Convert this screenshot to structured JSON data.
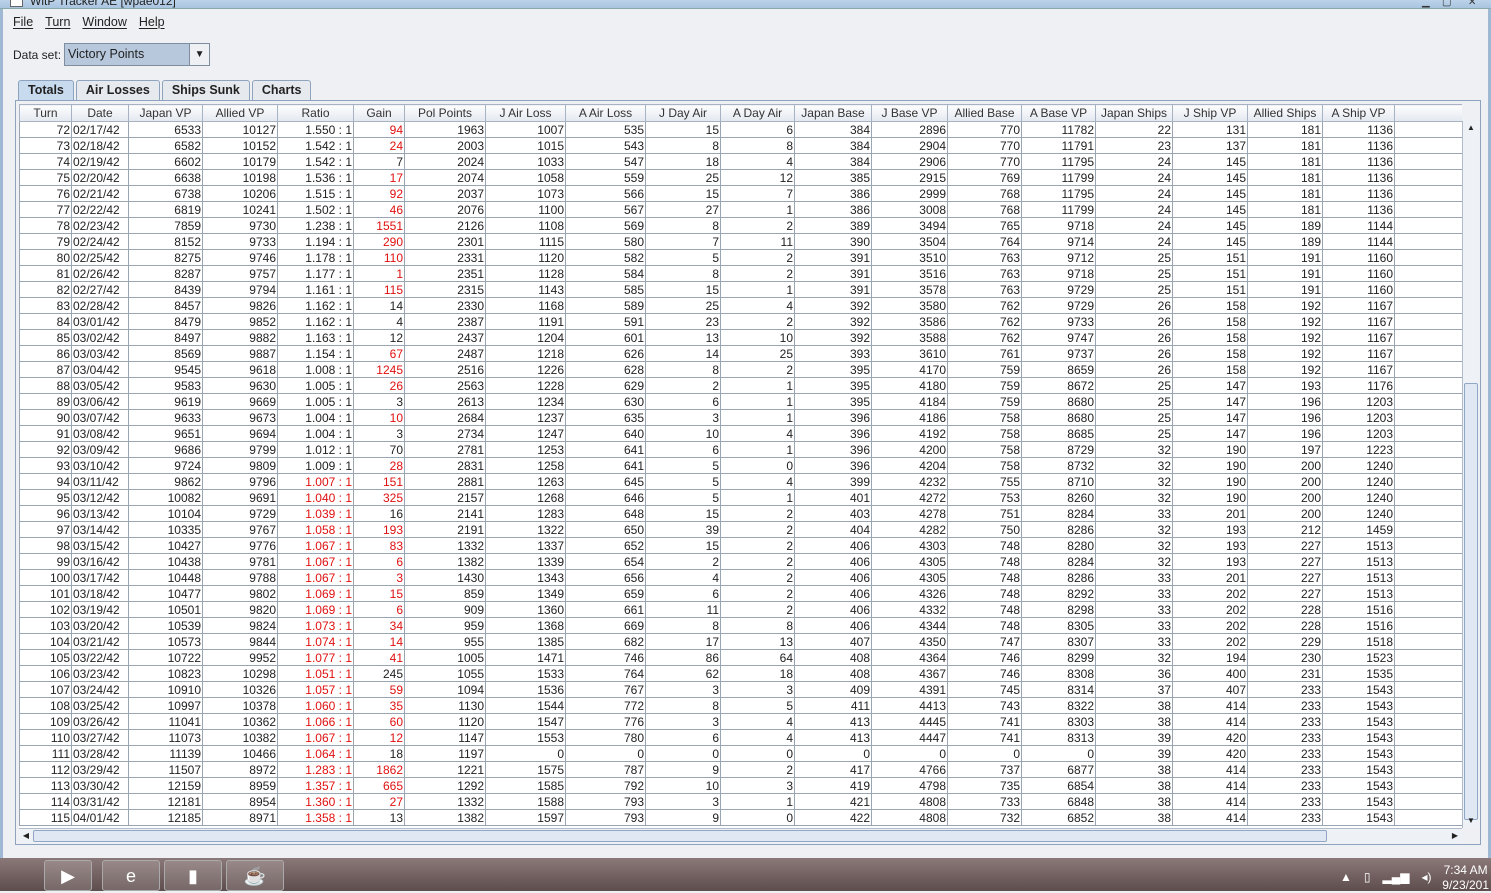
{
  "window": {
    "title": "WitP Tracker AE [wpae012]"
  },
  "menu": [
    "File",
    "Turn",
    "Window",
    "Help"
  ],
  "dataset": {
    "label": "Data set:",
    "value": "Victory Points"
  },
  "tabs": [
    "Totals",
    "Air Losses",
    "Ships Sunk",
    "Charts"
  ],
  "active_tab": "Totals",
  "colors": {
    "highlight": "#e01010",
    "selected_tab": "#c7daee"
  },
  "table": {
    "columns": [
      "Turn",
      "Date",
      "Japan VP",
      "Allied VP",
      "Ratio",
      "Gain",
      "Pol Points",
      "J Air Loss",
      "A Air Loss",
      "J Day Air",
      "A Day Air",
      "Japan Base",
      "J Base VP",
      "Allied Base",
      "A Base VP",
      "Japan Ships",
      "J Ship VP",
      "Allied Ships",
      "A Ship VP"
    ],
    "rows": [
      [
        "72",
        "02/17/42",
        "6533",
        "10127",
        "1.550 : 1",
        "94",
        "1963",
        "1007",
        "535",
        "15",
        "6",
        "384",
        "2896",
        "770",
        "11782",
        "22",
        "131",
        "181",
        "1136"
      ],
      [
        "73",
        "02/18/42",
        "6582",
        "10152",
        "1.542 : 1",
        "24",
        "2003",
        "1015",
        "543",
        "8",
        "8",
        "384",
        "2904",
        "770",
        "11791",
        "23",
        "137",
        "181",
        "1136"
      ],
      [
        "74",
        "02/19/42",
        "6602",
        "10179",
        "1.542 : 1",
        "7",
        "2024",
        "1033",
        "547",
        "18",
        "4",
        "384",
        "2906",
        "770",
        "11795",
        "24",
        "145",
        "181",
        "1136"
      ],
      [
        "75",
        "02/20/42",
        "6638",
        "10198",
        "1.536 : 1",
        "17",
        "2074",
        "1058",
        "559",
        "25",
        "12",
        "385",
        "2915",
        "769",
        "11799",
        "24",
        "145",
        "181",
        "1136"
      ],
      [
        "76",
        "02/21/42",
        "6738",
        "10206",
        "1.515 : 1",
        "92",
        "2037",
        "1073",
        "566",
        "15",
        "7",
        "386",
        "2999",
        "768",
        "11795",
        "24",
        "145",
        "181",
        "1136"
      ],
      [
        "77",
        "02/22/42",
        "6819",
        "10241",
        "1.502 : 1",
        "46",
        "2076",
        "1100",
        "567",
        "27",
        "1",
        "386",
        "3008",
        "768",
        "11799",
        "24",
        "145",
        "181",
        "1136"
      ],
      [
        "78",
        "02/23/42",
        "7859",
        "9730",
        "1.238 : 1",
        "1551",
        "2126",
        "1108",
        "569",
        "8",
        "2",
        "389",
        "3494",
        "765",
        "9718",
        "24",
        "145",
        "189",
        "1144"
      ],
      [
        "79",
        "02/24/42",
        "8152",
        "9733",
        "1.194 : 1",
        "290",
        "2301",
        "1115",
        "580",
        "7",
        "11",
        "390",
        "3504",
        "764",
        "9714",
        "24",
        "145",
        "189",
        "1144"
      ],
      [
        "80",
        "02/25/42",
        "8275",
        "9746",
        "1.178 : 1",
        "110",
        "2331",
        "1120",
        "582",
        "5",
        "2",
        "391",
        "3510",
        "763",
        "9712",
        "25",
        "151",
        "191",
        "1160"
      ],
      [
        "81",
        "02/26/42",
        "8287",
        "9757",
        "1.177 : 1",
        "1",
        "2351",
        "1128",
        "584",
        "8",
        "2",
        "391",
        "3516",
        "763",
        "9718",
        "25",
        "151",
        "191",
        "1160"
      ],
      [
        "82",
        "02/27/42",
        "8439",
        "9794",
        "1.161 : 1",
        "115",
        "2315",
        "1143",
        "585",
        "15",
        "1",
        "391",
        "3578",
        "763",
        "9729",
        "25",
        "151",
        "191",
        "1160"
      ],
      [
        "83",
        "02/28/42",
        "8457",
        "9826",
        "1.162 : 1",
        "14",
        "2330",
        "1168",
        "589",
        "25",
        "4",
        "392",
        "3580",
        "762",
        "9729",
        "26",
        "158",
        "192",
        "1167"
      ],
      [
        "84",
        "03/01/42",
        "8479",
        "9852",
        "1.162 : 1",
        "4",
        "2387",
        "1191",
        "591",
        "23",
        "2",
        "392",
        "3586",
        "762",
        "9733",
        "26",
        "158",
        "192",
        "1167"
      ],
      [
        "85",
        "03/02/42",
        "8497",
        "9882",
        "1.163 : 1",
        "12",
        "2437",
        "1204",
        "601",
        "13",
        "10",
        "392",
        "3588",
        "762",
        "9747",
        "26",
        "158",
        "192",
        "1167"
      ],
      [
        "86",
        "03/03/42",
        "8569",
        "9887",
        "1.154 : 1",
        "67",
        "2487",
        "1218",
        "626",
        "14",
        "25",
        "393",
        "3610",
        "761",
        "9737",
        "26",
        "158",
        "192",
        "1167"
      ],
      [
        "87",
        "03/04/42",
        "9545",
        "9618",
        "1.008 : 1",
        "1245",
        "2516",
        "1226",
        "628",
        "8",
        "2",
        "395",
        "4170",
        "759",
        "8659",
        "26",
        "158",
        "192",
        "1167"
      ],
      [
        "88",
        "03/05/42",
        "9583",
        "9630",
        "1.005 : 1",
        "26",
        "2563",
        "1228",
        "629",
        "2",
        "1",
        "395",
        "4180",
        "759",
        "8672",
        "25",
        "147",
        "193",
        "1176"
      ],
      [
        "89",
        "03/06/42",
        "9619",
        "9669",
        "1.005 : 1",
        "3",
        "2613",
        "1234",
        "630",
        "6",
        "1",
        "395",
        "4184",
        "759",
        "8680",
        "25",
        "147",
        "196",
        "1203"
      ],
      [
        "90",
        "03/07/42",
        "9633",
        "9673",
        "1.004 : 1",
        "10",
        "2684",
        "1237",
        "635",
        "3",
        "1",
        "396",
        "4186",
        "758",
        "8680",
        "25",
        "147",
        "196",
        "1203"
      ],
      [
        "91",
        "03/08/42",
        "9651",
        "9694",
        "1.004 : 1",
        "3",
        "2734",
        "1247",
        "640",
        "10",
        "4",
        "396",
        "4192",
        "758",
        "8685",
        "25",
        "147",
        "196",
        "1203"
      ],
      [
        "92",
        "03/09/42",
        "9686",
        "9799",
        "1.012 : 1",
        "70",
        "2781",
        "1253",
        "641",
        "6",
        "1",
        "396",
        "4200",
        "758",
        "8729",
        "32",
        "190",
        "197",
        "1223"
      ],
      [
        "93",
        "03/10/42",
        "9724",
        "9809",
        "1.009 : 1",
        "28",
        "2831",
        "1258",
        "641",
        "5",
        "0",
        "396",
        "4204",
        "758",
        "8732",
        "32",
        "190",
        "200",
        "1240"
      ],
      [
        "94",
        "03/11/42",
        "9862",
        "9796",
        "1.007 : 1",
        "151",
        "2881",
        "1263",
        "645",
        "5",
        "4",
        "399",
        "4232",
        "755",
        "8710",
        "32",
        "190",
        "200",
        "1240"
      ],
      [
        "95",
        "03/12/42",
        "10082",
        "9691",
        "1.040 : 1",
        "325",
        "2157",
        "1268",
        "646",
        "5",
        "1",
        "401",
        "4272",
        "753",
        "8260",
        "32",
        "190",
        "200",
        "1240"
      ],
      [
        "96",
        "03/13/42",
        "10104",
        "9729",
        "1.039 : 1",
        "16",
        "2141",
        "1283",
        "648",
        "15",
        "2",
        "403",
        "4278",
        "751",
        "8284",
        "33",
        "201",
        "200",
        "1240"
      ],
      [
        "97",
        "03/14/42",
        "10335",
        "9767",
        "1.058 : 1",
        "193",
        "2191",
        "1322",
        "650",
        "39",
        "2",
        "404",
        "4282",
        "750",
        "8286",
        "32",
        "193",
        "212",
        "1459"
      ],
      [
        "98",
        "03/15/42",
        "10427",
        "9776",
        "1.067 : 1",
        "83",
        "1332",
        "1337",
        "652",
        "15",
        "2",
        "406",
        "4303",
        "748",
        "8280",
        "32",
        "193",
        "227",
        "1513"
      ],
      [
        "99",
        "03/16/42",
        "10438",
        "9781",
        "1.067 : 1",
        "6",
        "1382",
        "1339",
        "654",
        "2",
        "2",
        "406",
        "4305",
        "748",
        "8284",
        "32",
        "193",
        "227",
        "1513"
      ],
      [
        "100",
        "03/17/42",
        "10448",
        "9788",
        "1.067 : 1",
        "3",
        "1430",
        "1343",
        "656",
        "4",
        "2",
        "406",
        "4305",
        "748",
        "8286",
        "33",
        "201",
        "227",
        "1513"
      ],
      [
        "101",
        "03/18/42",
        "10477",
        "9802",
        "1.069 : 1",
        "15",
        "859",
        "1349",
        "659",
        "6",
        "2",
        "406",
        "4326",
        "748",
        "8292",
        "33",
        "202",
        "227",
        "1513"
      ],
      [
        "102",
        "03/19/42",
        "10501",
        "9820",
        "1.069 : 1",
        "6",
        "909",
        "1360",
        "661",
        "11",
        "2",
        "406",
        "4332",
        "748",
        "8298",
        "33",
        "202",
        "228",
        "1516"
      ],
      [
        "103",
        "03/20/42",
        "10539",
        "9824",
        "1.073 : 1",
        "34",
        "959",
        "1368",
        "669",
        "8",
        "8",
        "406",
        "4344",
        "748",
        "8305",
        "33",
        "202",
        "228",
        "1516"
      ],
      [
        "104",
        "03/21/42",
        "10573",
        "9844",
        "1.074 : 1",
        "14",
        "955",
        "1385",
        "682",
        "17",
        "13",
        "407",
        "4350",
        "747",
        "8307",
        "33",
        "202",
        "229",
        "1518"
      ],
      [
        "105",
        "03/22/42",
        "10722",
        "9952",
        "1.077 : 1",
        "41",
        "1005",
        "1471",
        "746",
        "86",
        "64",
        "408",
        "4364",
        "746",
        "8299",
        "32",
        "194",
        "230",
        "1523"
      ],
      [
        "106",
        "03/23/42",
        "10823",
        "10298",
        "1.051 : 1",
        "245",
        "1055",
        "1533",
        "764",
        "62",
        "18",
        "408",
        "4367",
        "746",
        "8308",
        "36",
        "400",
        "231",
        "1535"
      ],
      [
        "107",
        "03/24/42",
        "10910",
        "10326",
        "1.057 : 1",
        "59",
        "1094",
        "1536",
        "767",
        "3",
        "3",
        "409",
        "4391",
        "745",
        "8314",
        "37",
        "407",
        "233",
        "1543"
      ],
      [
        "108",
        "03/25/42",
        "10997",
        "10378",
        "1.060 : 1",
        "35",
        "1130",
        "1544",
        "772",
        "8",
        "5",
        "411",
        "4413",
        "743",
        "8322",
        "38",
        "414",
        "233",
        "1543"
      ],
      [
        "109",
        "03/26/42",
        "11041",
        "10362",
        "1.066 : 1",
        "60",
        "1120",
        "1547",
        "776",
        "3",
        "4",
        "413",
        "4445",
        "741",
        "8303",
        "38",
        "414",
        "233",
        "1543"
      ],
      [
        "110",
        "03/27/42",
        "11073",
        "10382",
        "1.067 : 1",
        "12",
        "1147",
        "1553",
        "780",
        "6",
        "4",
        "413",
        "4447",
        "741",
        "8313",
        "39",
        "420",
        "233",
        "1543"
      ],
      [
        "111",
        "03/28/42",
        "11139",
        "10466",
        "1.064 : 1",
        "18",
        "1197",
        "0",
        "0",
        "0",
        "0",
        "0",
        "0",
        "0",
        "0",
        "39",
        "420",
        "233",
        "1543"
      ],
      [
        "112",
        "03/29/42",
        "11507",
        "8972",
        "1.283 : 1",
        "1862",
        "1221",
        "1575",
        "787",
        "9",
        "2",
        "417",
        "4766",
        "737",
        "6877",
        "38",
        "414",
        "233",
        "1543"
      ],
      [
        "113",
        "03/30/42",
        "12159",
        "8959",
        "1.357 : 1",
        "665",
        "1292",
        "1585",
        "792",
        "10",
        "3",
        "419",
        "4798",
        "735",
        "6854",
        "38",
        "414",
        "233",
        "1543"
      ],
      [
        "114",
        "03/31/42",
        "12181",
        "8954",
        "1.360 : 1",
        "27",
        "1332",
        "1588",
        "793",
        "3",
        "1",
        "421",
        "4808",
        "733",
        "6848",
        "38",
        "414",
        "233",
        "1543"
      ],
      [
        "115",
        "04/01/42",
        "12185",
        "8971",
        "1.358 : 1",
        "13",
        "1382",
        "1597",
        "793",
        "9",
        "0",
        "422",
        "4808",
        "732",
        "6852",
        "38",
        "414",
        "233",
        "1543"
      ]
    ],
    "red_gain_turns": [
      "72",
      "73",
      "75",
      "76",
      "77",
      "78",
      "79",
      "80",
      "81",
      "82",
      "86",
      "87",
      "88",
      "90",
      "93",
      "94",
      "95",
      "97",
      "98",
      "99",
      "100",
      "101",
      "102",
      "103",
      "104",
      "105",
      "107",
      "108",
      "109",
      "110",
      "112",
      "113",
      "114"
    ],
    "red_ratio_turns": [
      "94",
      "95",
      "96",
      "97",
      "98",
      "99",
      "100",
      "101",
      "102",
      "103",
      "104",
      "105",
      "106",
      "107",
      "108",
      "109",
      "110",
      "111",
      "112",
      "113",
      "114",
      "115"
    ]
  },
  "taskbar": {
    "time": "7:34 AM",
    "date": "9/23/201"
  }
}
